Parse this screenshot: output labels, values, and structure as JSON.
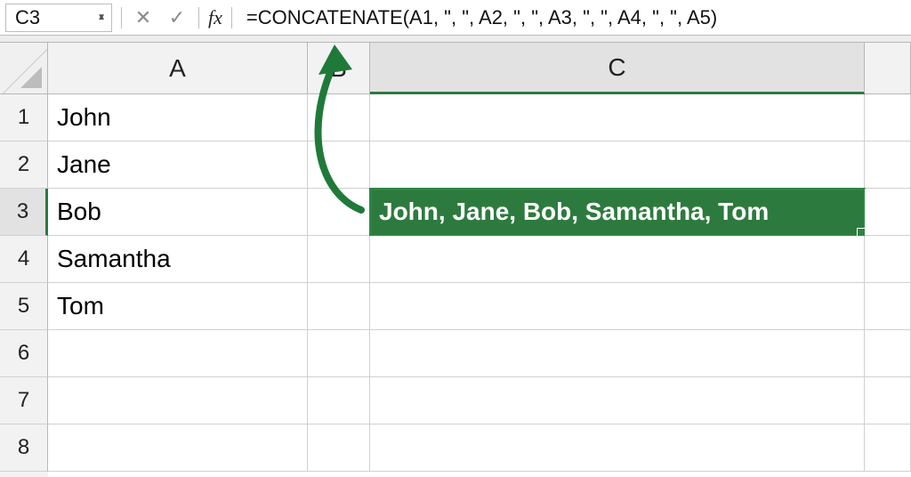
{
  "name_box": {
    "value": "C3"
  },
  "formula_bar": {
    "cancel_icon": "✕",
    "enter_icon": "✓",
    "fx_label": "fx",
    "formula": "=CONCATENATE(A1, \", \", A2, \", \", A3, \", \", A4, \", \", A5)"
  },
  "columns": [
    "A",
    "B",
    "C"
  ],
  "row_count": 8,
  "selected_cell": "C3",
  "cells": {
    "A1": "John",
    "A2": "Jane",
    "A3": "Bob",
    "A4": "Samantha",
    "A5": "Tom",
    "C3": "John, Jane, Bob, Samantha, Tom"
  },
  "annotation": {
    "arrow_color": "#1f7a3a"
  }
}
